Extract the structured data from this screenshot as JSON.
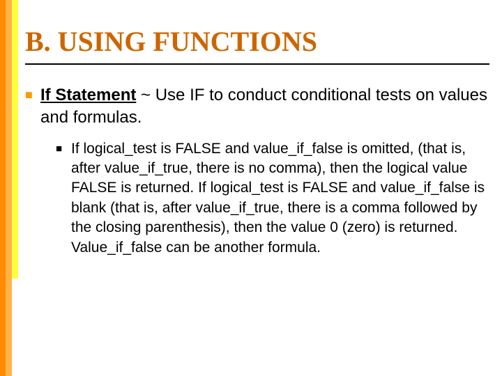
{
  "title": "B. USING FUNCTIONS",
  "main": {
    "heading": "If Statement",
    "separator": " ~ ",
    "description": "Use IF to conduct conditional tests on values and formulas."
  },
  "sub": {
    "text": "If logical_test is FALSE and value_if_false is omitted, (that is, after value_if_true, there is no comma), then the logical value FALSE is returned. If logical_test is FALSE and value_if_false is blank (that is, after value_if_true, there is a comma followed by the closing parenthesis), then the value 0 (zero) is returned. Value_if_false can be another formula."
  }
}
